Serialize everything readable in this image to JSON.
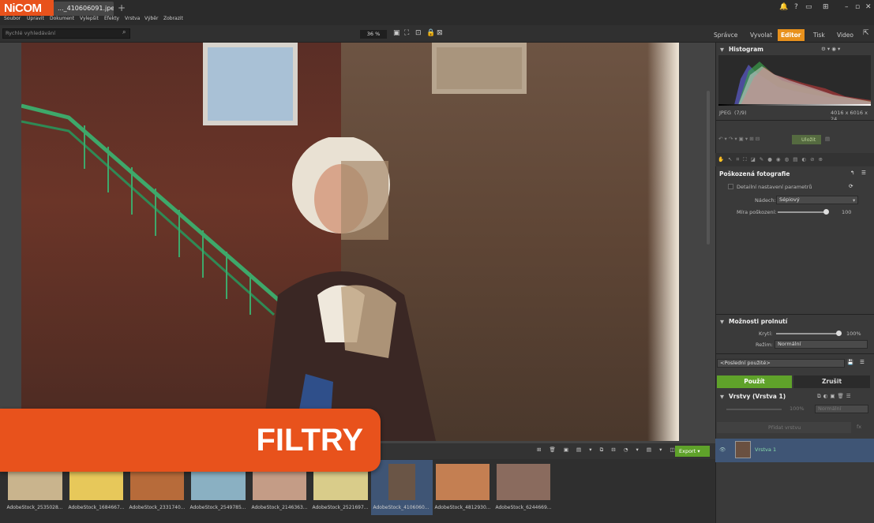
{
  "app": {
    "logo": "NiCOM",
    "file_tab": "..._4106060​91.jpeg",
    "new_tab": "+"
  },
  "menu": [
    "Soubor",
    "Upravit",
    "Dokument",
    "Vylepšit",
    "Efekty",
    "Vrstva",
    "Výběr",
    "Zobrazit"
  ],
  "toolbar": {
    "search_placeholder": "Rychlé vyhledávání",
    "zoom": "36 %"
  },
  "modes": [
    "Správce",
    "Vyvolat",
    "Editor",
    "Tisk",
    "Video"
  ],
  "active_mode": "Editor",
  "histogram": {
    "title": "Histogram",
    "format": "JPEG",
    "index": "(7/9)",
    "dimensions": "4016 x 6016 x 24"
  },
  "panel": {
    "save_label": "Uložit",
    "filter_title": "Poškozená fotografie",
    "detail_label": "Detailní nastavení parametrů",
    "tint_label": "Nádech:",
    "tint_value": "Sépiový",
    "damage_label": "Míra poškození:",
    "damage_value": "100",
    "blend_title": "Možnosti prolnutí",
    "opacity_label": "Krytí:",
    "opacity_value": "100%",
    "mode_label": "Režim:",
    "mode_value": "Normální",
    "preset_value": "<Poslední použité>",
    "apply_label": "Použít",
    "cancel_label": "Zrušit",
    "layers_title": "Vrstvy (Vrstva 1)",
    "layers_opacity": "100%",
    "layers_mode": "Normální",
    "add_layer": "Přidat vrstvu",
    "layer_name": "Vrstva 1"
  },
  "filmstrip": {
    "export_label": "Export",
    "thumbnails": [
      {
        "caption": "AdobeStock_2535028...",
        "color": "#c9b48d"
      },
      {
        "caption": "AdobeStock_1684667...",
        "color": "#e7c85a"
      },
      {
        "caption": "AdobeStock_2331740...",
        "color": "#b76b3a"
      },
      {
        "caption": "AdobeStock_2549785...",
        "color": "#8ab0c2"
      },
      {
        "caption": "AdobeStock_2146363...",
        "color": "#c49c86"
      },
      {
        "caption": "AdobeStock_2521697...",
        "color": "#d9cc8a"
      },
      {
        "caption": "AdobeStock_4106060...",
        "color": "#6a5546"
      },
      {
        "caption": "AdobeStock_4812930...",
        "color": "#c47f52"
      },
      {
        "caption": "AdobeStock_6244669...",
        "color": "#8a6b5e"
      }
    ]
  },
  "banner": "FILTRY"
}
